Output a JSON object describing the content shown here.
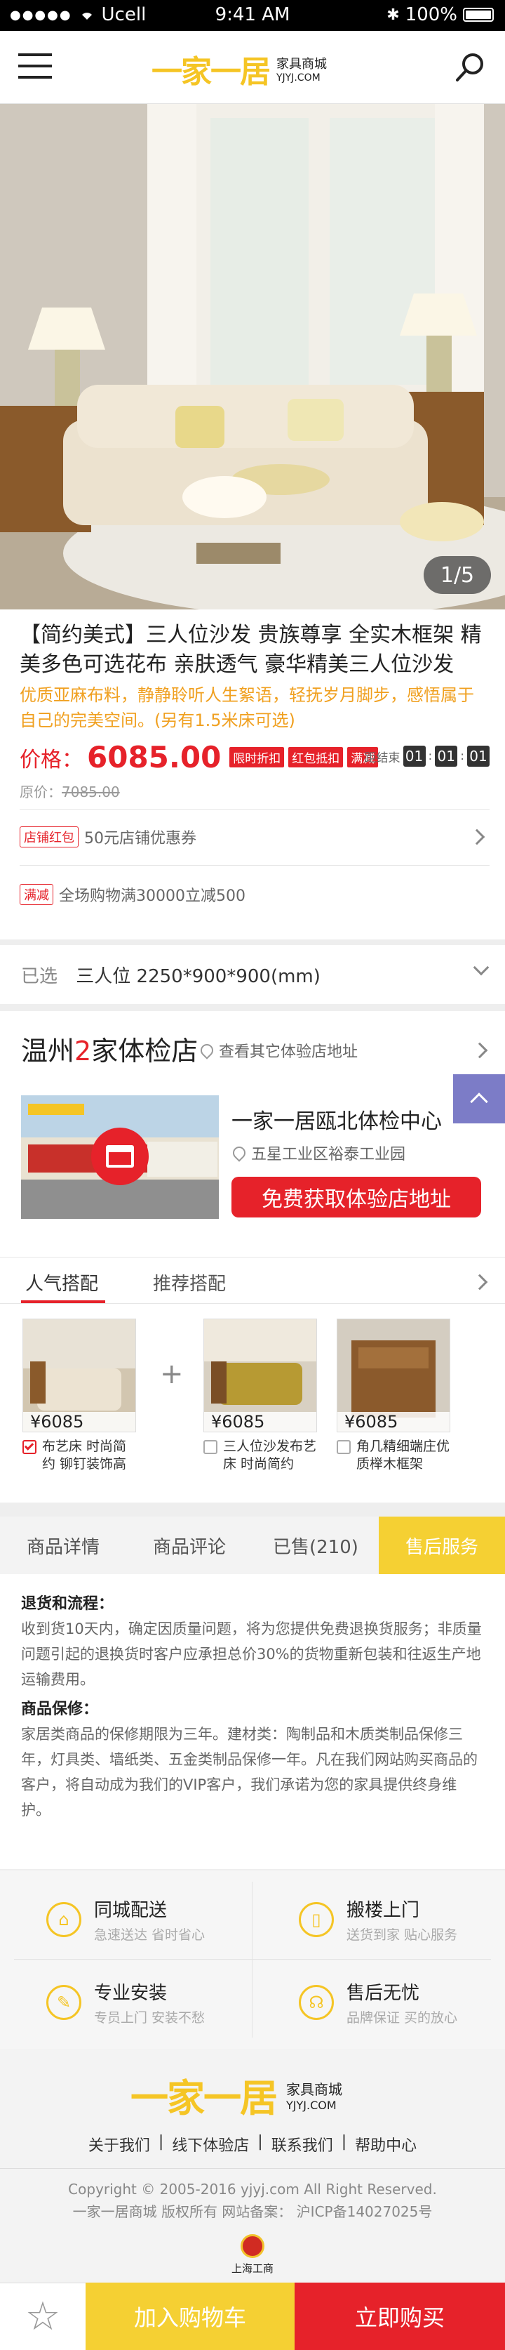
{
  "status_bar": {
    "carrier": "Ucell",
    "time": "9:41 AM",
    "battery": "100%"
  },
  "header": {
    "logo_text": "一家一居",
    "brand_name": "家具商城",
    "brand_domain": "YJYJ.COM"
  },
  "gallery": {
    "pager": "1/5"
  },
  "product": {
    "title": "【简约美式】三人位沙发 贵族尊享 全实木框架 精美多色可选花布 亲肤透气 豪华精美三人位沙发",
    "subtitle": "优质亚麻布料，静静聆听人生絮语，轻抚岁月脚步，感悟属于自己的完美空间。(另有1.5米床可选)",
    "price_label": "价格：",
    "price": "6085.00",
    "tags": [
      "限时折扣",
      "红包抵扣",
      "满减"
    ],
    "countdown_label": "距结束",
    "countdown": [
      "01",
      "01",
      "01"
    ],
    "original_label": "原价：",
    "original_price": "7085.00"
  },
  "promos": [
    {
      "tag": "店铺红包",
      "text": "50元店铺优惠券"
    },
    {
      "tag": "满减",
      "text": "全场购物满30000立减500"
    }
  ],
  "selection": {
    "label": "已选",
    "value": "三人位  2250*900*900(mm)"
  },
  "store": {
    "title_prefix": "温州",
    "title_count": "2",
    "title_suffix": "家体检店",
    "link": "查看其它体验店地址",
    "name": "一家一居瓯北体检中心",
    "address": "五星工业区裕泰工业园",
    "button": "免费获取体验店地址"
  },
  "combo": {
    "tabs": [
      "人气搭配",
      "推荐搭配"
    ],
    "items": [
      {
        "price": "¥6085",
        "name": "布艺床 时尚简约 铆钉装饰高",
        "checked": true
      },
      {
        "price": "¥6085",
        "name": "三人位沙发布艺床 时尚简约",
        "checked": false
      },
      {
        "price": "¥6085",
        "name": "角几精细端庄优质榉木框架",
        "checked": false
      }
    ]
  },
  "detail_tabs": [
    "商品详情",
    "商品评论",
    "已售(210)",
    "售后服务"
  ],
  "policy": {
    "h1": "退货和流程：",
    "p1": "收到货10天内，确定因质量问题，将为您提供免费退换货服务；非质量问题引起的退换货时客户应承担总价30%的货物重新包装和往返生产地运输费用。",
    "h2": "商品保修：",
    "p2": "家居类商品的保修期限为三年。建材类：陶制品和木质类制品保修三年，灯具类、墙纸类、五金类制品保修一年。凡在我们网站购买商品的客户，将自动成为我们的VIP客户，我们承诺为您的家具提供终身维护。"
  },
  "services": [
    {
      "title": "同城配送",
      "sub": "急速送达 省时省心",
      "icon": "house-icon"
    },
    {
      "title": "搬楼上门",
      "sub": "送货到家 贴心服务",
      "icon": "phone-icon"
    },
    {
      "title": "专业安装",
      "sub": "专员上门 安装不愁",
      "icon": "wrench-icon"
    },
    {
      "title": "售后无忧",
      "sub": "品牌保证 买的放心",
      "icon": "headset-icon"
    }
  ],
  "footer": {
    "links": [
      "关于我们",
      "线下体验店",
      "联系我们",
      "帮助中心"
    ],
    "copyright": "Copyright © 2005-2016 yjyj.com All Right Reserved.",
    "icp": "一家一居商城 版权所有  网站备案： 沪ICP备14027025号",
    "badge": "上海工商"
  },
  "bottom_bar": {
    "cart": "加入购物车",
    "buy": "立即购买"
  },
  "colors": {
    "accent_red": "#e6222a",
    "accent_yellow": "#f5d033"
  }
}
